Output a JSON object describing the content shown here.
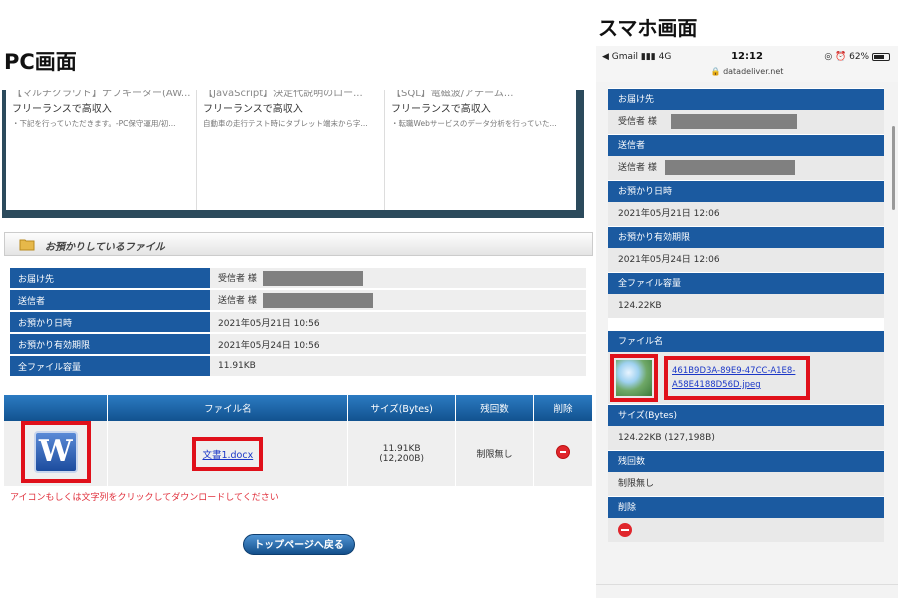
{
  "captions": {
    "pc": "PC画面",
    "sp": "スマホ画面"
  },
  "pc": {
    "ads": [
      {
        "head": "【マルチクラウド】ナブキーター(AW...",
        "sub": "フリーランスで高収入",
        "desc": "・下記を行っていただきます。-PC保守運用/初..."
      },
      {
        "head": "【JavaScript】決定代説明のロー...",
        "sub": "フリーランスで高収入",
        "desc": "自動車の走行テスト時にタブレット端末から字..."
      },
      {
        "head": "【SQL】電磁波/アテーム...",
        "sub": "フリーランスで高収入",
        "desc": "・転職Webサービスのデータ分析を行っていた..."
      }
    ],
    "section_title": "お預かりしているファイル",
    "info_rows": [
      {
        "label": "お届け先",
        "value": "受信者 様"
      },
      {
        "label": "送信者",
        "value": "送信者 様"
      },
      {
        "label": "お預かり日時",
        "value": "2021年05月21日 10:56"
      },
      {
        "label": "お預かり有効期限",
        "value": "2021年05月24日 10:56"
      },
      {
        "label": "全ファイル容量",
        "value": "11.91KB"
      }
    ],
    "file_table": {
      "headers": [
        "ファイル名",
        "サイズ(Bytes)",
        "残回数",
        "削除"
      ],
      "file_name": "文書1.docx",
      "size_kb": "11.91KB",
      "size_bytes": "(12,200B)",
      "remaining": "制限無し"
    },
    "word_icon_letter": "W",
    "download_note": "アイコンもしくは文字列をクリックしてダウンロードしてください",
    "back_button": "トップページへ戻る"
  },
  "sp": {
    "status": {
      "carrier": "◀ Gmail ▮▮▮ 4G",
      "time": "12:12",
      "right": "◎ ⏰ 62%",
      "url": "🔒 datadeliver.net"
    },
    "rows": [
      {
        "label": "お届け先",
        "value": "受信者 様"
      },
      {
        "label": "送信者",
        "value": "送信者 様"
      },
      {
        "label": "お預かり日時",
        "value": "2021年05月21日 12:06"
      },
      {
        "label": "お預かり有効期限",
        "value": "2021年05月24日 12:06"
      },
      {
        "label": "全ファイル容量",
        "value": "124.22KB"
      }
    ],
    "file_label": "ファイル名",
    "file_name_line1": "461B9D3A-89E9-47CC-A1E8-",
    "file_name_line2": "A58E4188D56D.jpeg",
    "size_label": "サイズ(Bytes)",
    "size_value": "124.22KB (127,198B)",
    "remaining_label": "残回数",
    "remaining_value": "制限無し",
    "delete_label": "削除"
  },
  "colors": {
    "header_blue": "#1b5aa0",
    "highlight_red": "#e0101a",
    "link_blue": "#1b37c7"
  }
}
